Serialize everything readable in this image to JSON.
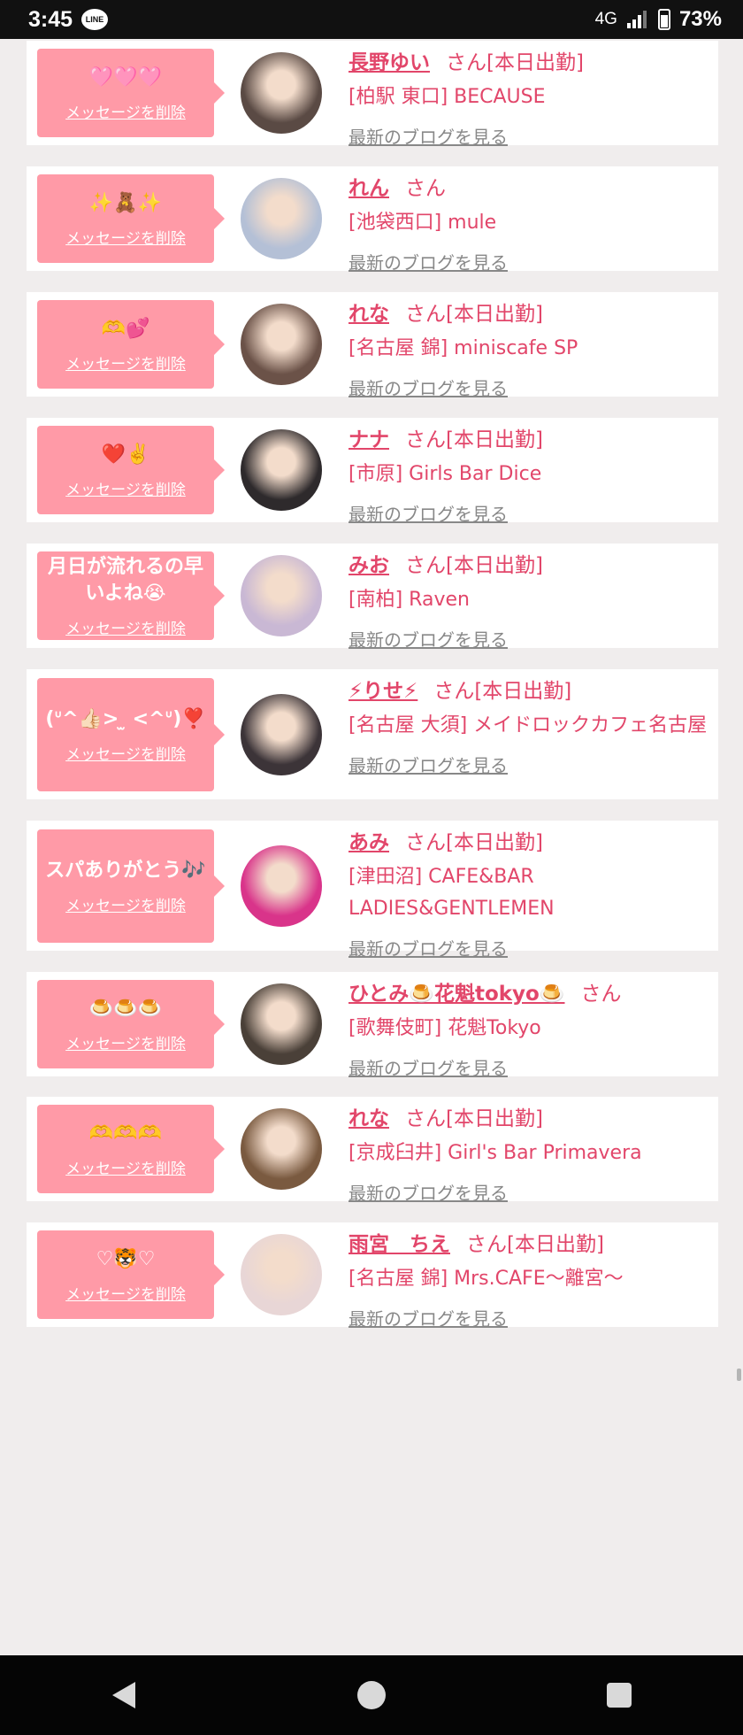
{
  "status_bar": {
    "time": "3:45",
    "app_badge": "LINE",
    "network": "4G",
    "battery": "73%"
  },
  "common": {
    "delete_label": "メッセージを削除",
    "blog_label": "最新のブログを見る",
    "san": "さん",
    "today_tag": "[本日出勤]"
  },
  "entries": [
    {
      "message": "🩷🩷🩷",
      "name": "長野ゆい",
      "suffix": "さん[本日出勤]",
      "shop": "[柏駅 東口] BECAUSE",
      "avatar_color": "#5a4a44"
    },
    {
      "message": "✨🧸✨",
      "name": "れん",
      "suffix": "さん",
      "shop": "[池袋西口] mule",
      "avatar_color": "#b4c0d6"
    },
    {
      "message": "🫶💕",
      "name": "れな",
      "suffix": "さん[本日出勤]",
      "shop": "[名古屋 錦] miniscafe SP",
      "avatar_color": "#6b5248"
    },
    {
      "message": "❤️✌️",
      "name": "ナナ",
      "suffix": "さん[本日出勤]",
      "shop": "[市原] Girls Bar Dice",
      "avatar_color": "#2e2a2c"
    },
    {
      "message": "月日が流れるの早いよね😭",
      "name": "みお",
      "suffix": "さん[本日出勤]",
      "shop": "[南柏] Raven",
      "avatar_color": "#c9b8d4"
    },
    {
      "message": "(ᐡ^👍🏻> ̫ <^ᐡ)❣️",
      "name": "⚡りせ⚡",
      "suffix": "さん[本日出勤]",
      "shop": "[名古屋 大須] メイドロックカフェ名古屋",
      "avatar_color": "#3c3438"
    },
    {
      "message": "スパありがとう🎶",
      "name": "あみ",
      "suffix": "さん[本日出勤]",
      "shop": "[津田沼] CAFE&BAR LADIES&GENTLEMEN",
      "avatar_color": "#d9348a"
    },
    {
      "message": "🍮🍮🍮",
      "name": "ひとみ🍮花魁tokyo🍮",
      "suffix": "さん",
      "shop": "[歌舞伎町] 花魁Tokyo",
      "avatar_color": "#4a4038"
    },
    {
      "message": "🫶🫶🫶",
      "name": "れな",
      "suffix": "さん[本日出勤]",
      "shop": "[京成臼井] Girl's Bar Primavera",
      "avatar_color": "#7a5a40"
    },
    {
      "message": "♡🐯♡",
      "name": "雨宮　ちえ",
      "suffix": "さん[本日出勤]",
      "shop": "[名古屋 錦] Mrs.CAFE〜離宮〜",
      "avatar_color": "#e8d6d6"
    }
  ]
}
